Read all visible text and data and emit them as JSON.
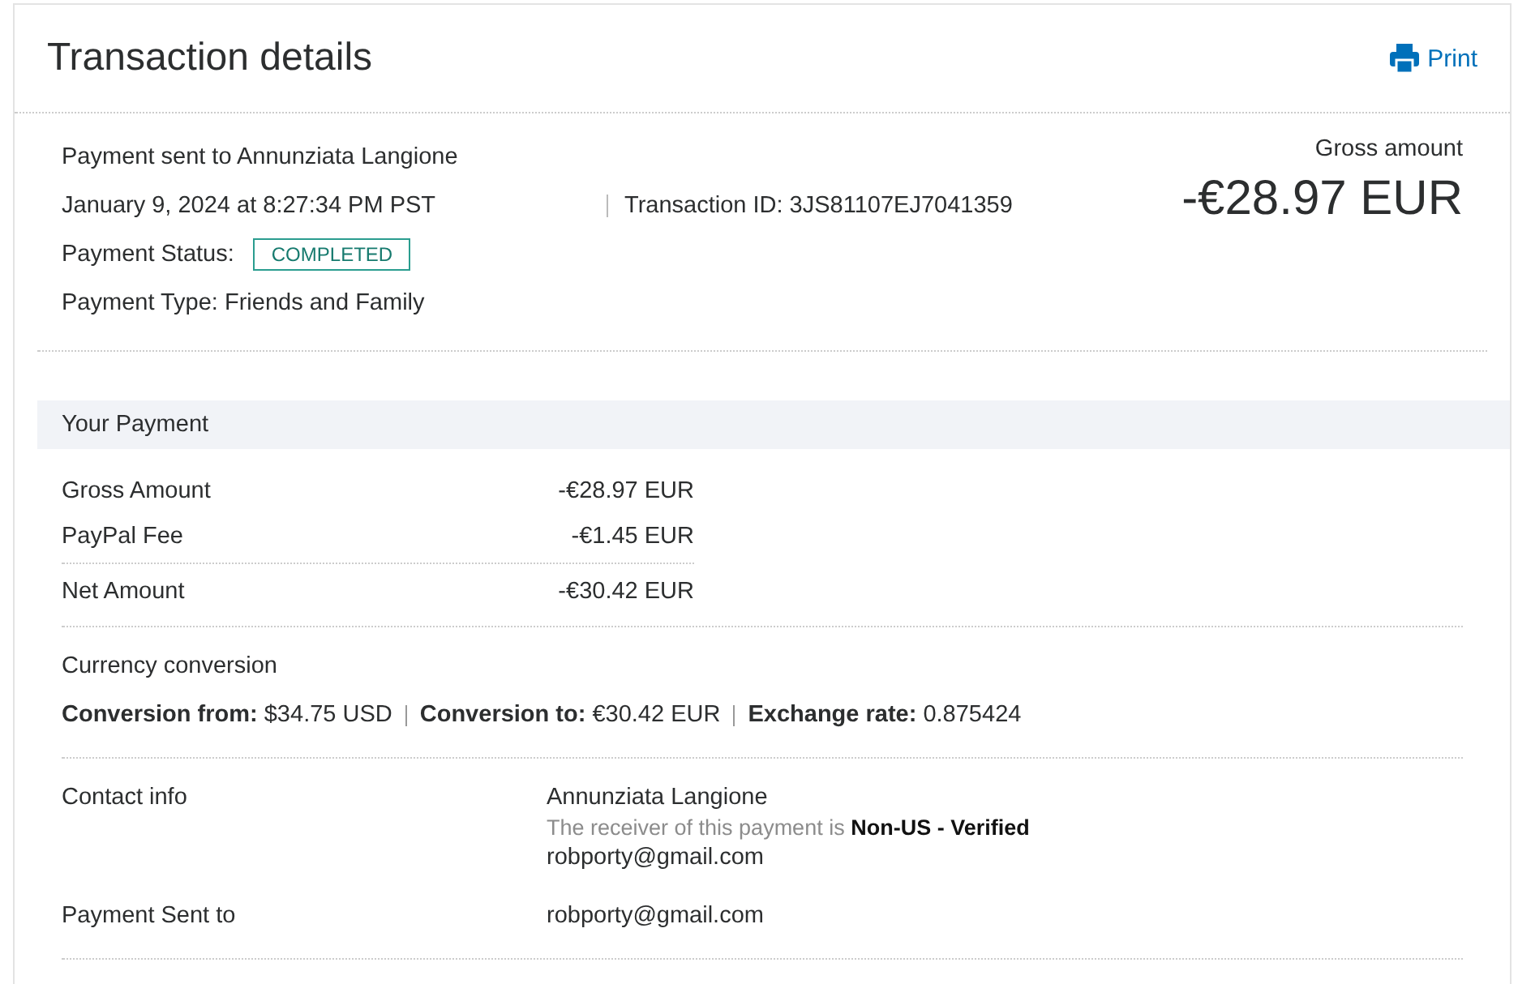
{
  "header": {
    "title": "Transaction details",
    "print": "Print"
  },
  "summary": {
    "payee": "Payment sent to Annunziata Langione",
    "date": "January 9, 2024 at 8:27:34 PM PST",
    "transaction_id": "Transaction ID: 3JS81107EJ7041359",
    "status_label": "Payment Status:",
    "status": "COMPLETED",
    "type": "Payment Type: Friends and Family",
    "gross_label": "Gross amount",
    "gross": "-€28.97 EUR"
  },
  "your_payment": {
    "heading": "Your Payment",
    "rows": [
      {
        "label": "Gross Amount",
        "value": "-€28.97 EUR"
      },
      {
        "label": "PayPal Fee",
        "value": "-€1.45 EUR"
      },
      {
        "label": "Net Amount",
        "value": "-€30.42 EUR"
      }
    ]
  },
  "conversion": {
    "heading": "Currency conversion",
    "items": [
      "**Conversion from:** $34.75 USD",
      "**Conversion to:** €30.42 EUR",
      "**Exchange rate:** 0.875424"
    ]
  },
  "contact": {
    "label": "Contact info",
    "name": "Annunziata Langione",
    "note": "The receiver of this payment is **Non-US - Verified**",
    "email": "robporty@gmail.com"
  },
  "sent_to": {
    "label": "Payment Sent to",
    "value": "robporty@gmail.com"
  }
}
